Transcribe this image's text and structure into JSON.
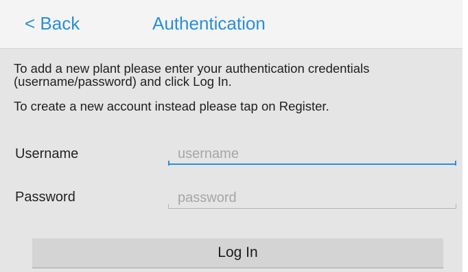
{
  "navbar": {
    "back_label": "< Back",
    "title": "Authentication"
  },
  "instructions": {
    "line1": "To add a new plant please enter your authentication credentials (username/password) and click Log In.",
    "line2": "To create a new account instead please tap on Register."
  },
  "form": {
    "username_label": "Username",
    "username_placeholder": "username",
    "username_value": "",
    "password_label": "Password",
    "password_placeholder": "password",
    "password_value": "",
    "login_label": "Log In"
  },
  "colors": {
    "accent": "#2a8fd6",
    "background": "#e5e5e5",
    "navbar_background": "#f4f4f4",
    "button_background": "#d4d4d4"
  }
}
